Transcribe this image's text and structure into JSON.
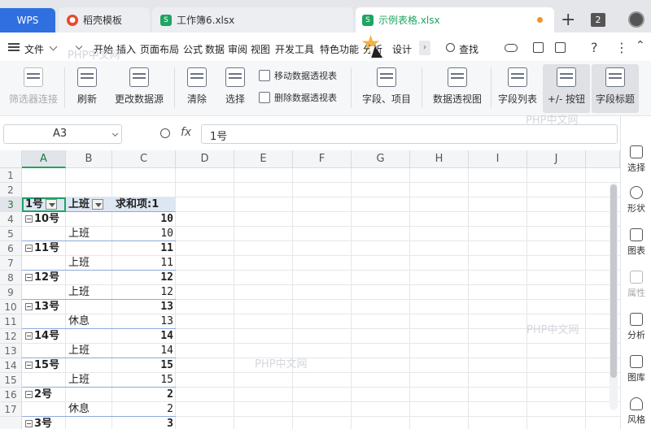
{
  "tabs": {
    "wps": "WPS",
    "t1": "稻壳模板",
    "t2": "工作簿6.xlsx",
    "t3": "示例表格.xlsx",
    "badge": "2",
    "plus": "+"
  },
  "menu": {
    "file": "文件",
    "items": [
      "开始",
      "插入",
      "页面布局",
      "公式",
      "数据",
      "审阅",
      "视图",
      "开发工具",
      "特色功能",
      "分析",
      "设计"
    ],
    "search": "查找"
  },
  "toolbar": {
    "filter_conn": "筛选器连接",
    "refresh": "刷新",
    "change_src": "更改数据源",
    "clear": "清除",
    "select": "选择",
    "move_pivot": "移动数据透视表",
    "del_pivot": "删除数据透视表",
    "fields_items": "字段、项目",
    "pivot_chart": "数据透视图",
    "field_list": "字段列表",
    "plus_minus": "+/- 按钮",
    "field_header": "字段标题"
  },
  "formula": {
    "cell_ref": "A3",
    "fx": "fx",
    "value": "1号"
  },
  "columns": [
    "A",
    "B",
    "C",
    "D",
    "E",
    "F",
    "G",
    "H",
    "I",
    "J"
  ],
  "rows": [
    "1",
    "2",
    "3",
    "4",
    "5",
    "6",
    "7",
    "8",
    "9",
    "10",
    "11",
    "12",
    "13",
    "14",
    "15",
    "16",
    "17"
  ],
  "pivot": {
    "header_a": "1号",
    "header_b": "上班",
    "header_c": "求和项:1",
    "r4a": "10号",
    "r4c": "10",
    "r5b": "上班",
    "r5c": "10",
    "r6a": "11号",
    "r6c": "11",
    "r7b": "上班",
    "r7c": "11",
    "r8a": "12号",
    "r8c": "12",
    "r9b": "上班",
    "r9c": "12",
    "r10a": "13号",
    "r10c": "13",
    "r11b": "休息",
    "r11c": "13",
    "r12a": "14号",
    "r12c": "14",
    "r13b": "上班",
    "r13c": "14",
    "r14a": "15号",
    "r14c": "15",
    "r15b": "上班",
    "r15c": "15",
    "r16a": "2号",
    "r16c": "2",
    "r17b": "休息",
    "r17c": "2",
    "r18a": "3号",
    "r18c": "3"
  },
  "sidebar": [
    "选择",
    "形状",
    "图表",
    "属性",
    "分析",
    "图库",
    "风格"
  ],
  "watermark": "PHP中文网"
}
